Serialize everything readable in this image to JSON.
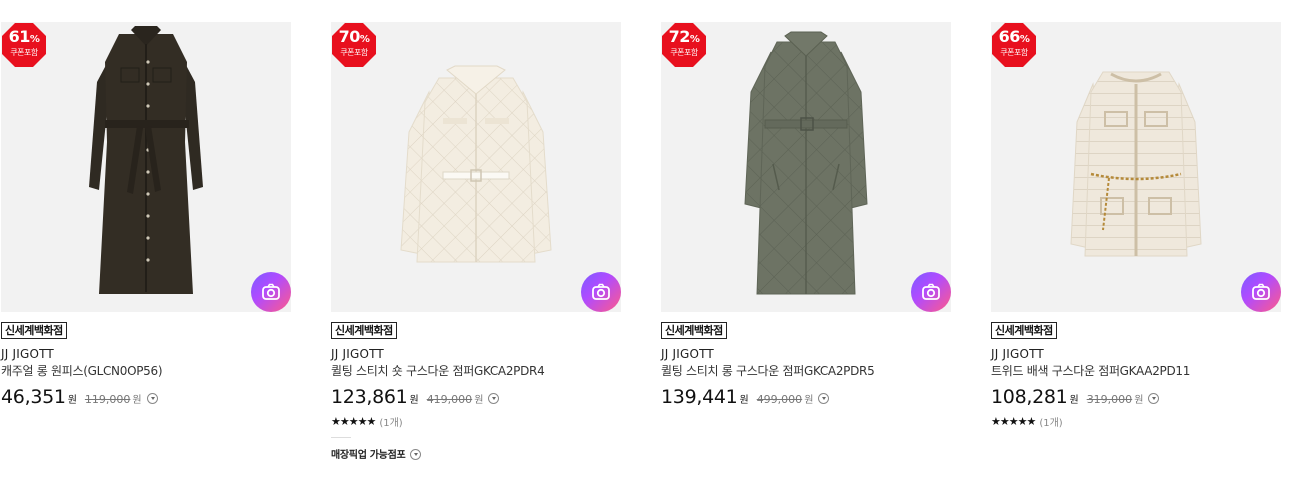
{
  "products": [
    {
      "discount": "61",
      "percent_sign": "%",
      "coupon_label": "쿠폰포함",
      "store": "신세계백화점",
      "brand": "JJ JIGOTT",
      "name": "캐주얼 롱 원피스(GLCN0OP56)",
      "price": "46,351",
      "price_unit": "원",
      "original_price": "119,000",
      "original_unit": "원"
    },
    {
      "discount": "70",
      "percent_sign": "%",
      "coupon_label": "쿠폰포함",
      "store": "신세계백화점",
      "brand": "JJ JIGOTT",
      "name": "퀼팅 스티치 숏 구스다운 점퍼GKCA2PDR4",
      "price": "123,861",
      "price_unit": "원",
      "original_price": "419,000",
      "original_unit": "원",
      "stars": "★★★★★",
      "review_count": "(1개)",
      "pickup_label": "매장픽업 가능점포"
    },
    {
      "discount": "72",
      "percent_sign": "%",
      "coupon_label": "쿠폰포함",
      "store": "신세계백화점",
      "brand": "JJ JIGOTT",
      "name": "퀼팅 스티치 롱 구스다운 점퍼GKCA2PDR5",
      "price": "139,441",
      "price_unit": "원",
      "original_price": "499,000",
      "original_unit": "원"
    },
    {
      "discount": "66",
      "percent_sign": "%",
      "coupon_label": "쿠폰포함",
      "store": "신세계백화점",
      "brand": "JJ JIGOTT",
      "name": "트위드 배색 구스다운 점퍼GKAA2PD11",
      "price": "108,281",
      "price_unit": "원",
      "original_price": "319,000",
      "original_unit": "원",
      "stars": "★★★★★",
      "review_count": "(1개)"
    }
  ],
  "colors": {
    "badge_red": "#e8101e",
    "image_bg": "#f2f2f2",
    "garment_dark_brown": "#2f2a22",
    "garment_cream": "#f3ede1",
    "garment_khaki": "#6d7364",
    "garment_ivory": "#efe8dc"
  },
  "icons": {
    "badge": "octagon-badge",
    "image_search": "camera-icon",
    "dropdown": "chevron-down-circle-icon"
  }
}
